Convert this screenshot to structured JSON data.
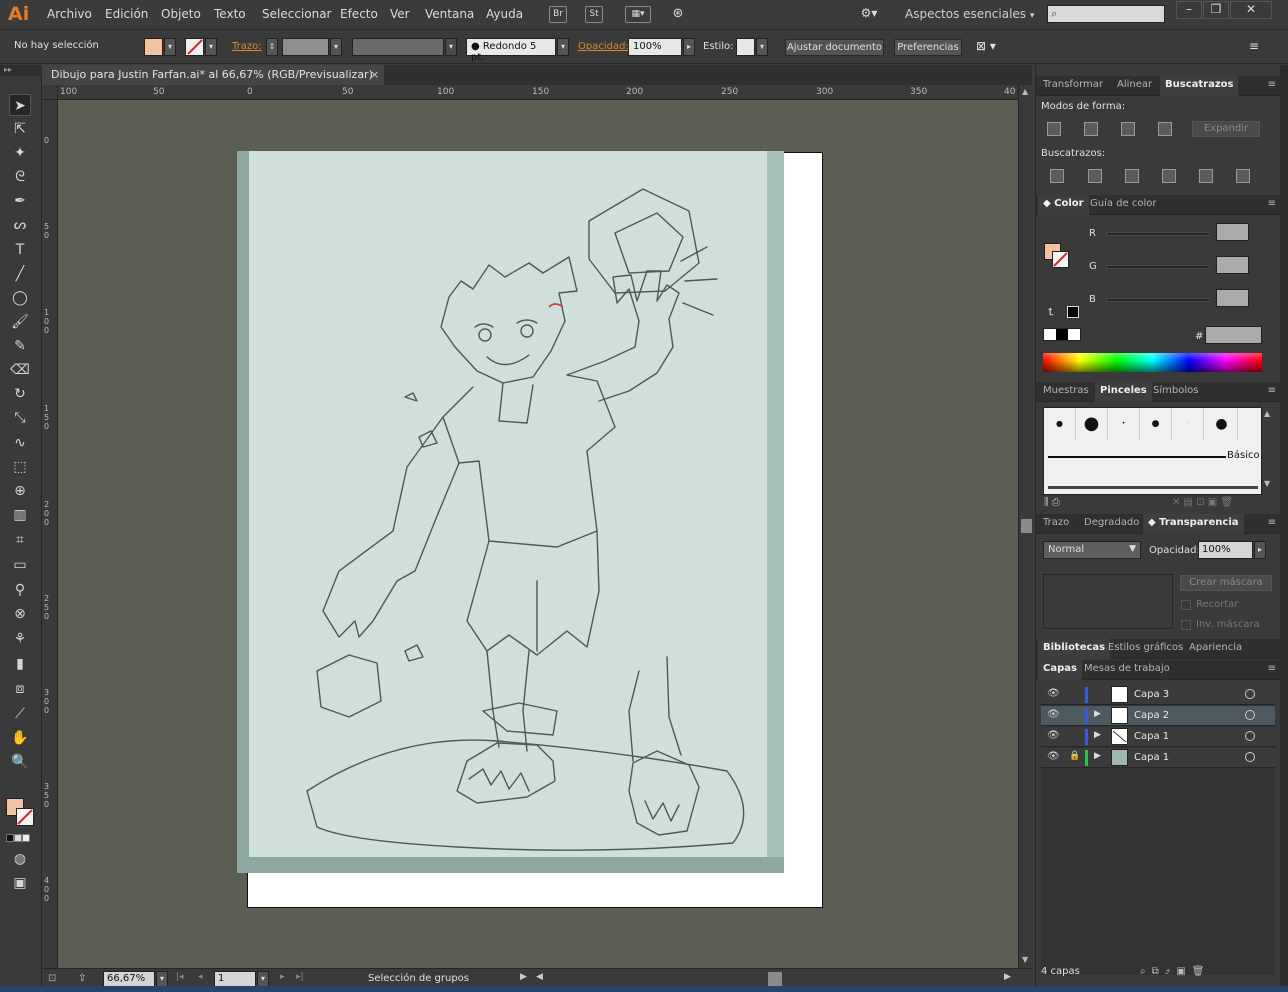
{
  "app": {
    "logo": "Ai",
    "menu": [
      "Archivo",
      "Edición",
      "Objeto",
      "Texto",
      "Seleccionar",
      "Efecto",
      "Ver",
      "Ventana",
      "Ayuda"
    ],
    "workspace": "Aspectos esenciales",
    "window_buttons": [
      "–",
      "❐",
      "✕"
    ]
  },
  "control_bar": {
    "selection_status": "No hay selección",
    "stroke_label": "Trazo:",
    "brush_value": "Redondo 5 pt.",
    "opacity_label": "Opacidad:",
    "opacity_value": "100%",
    "style_label": "Estilo:",
    "adjust_button": "Ajustar documento",
    "prefs_button": "Preferencias"
  },
  "document": {
    "tab_title": "Dibujo para Justin Farfan.ai* al 66,67% (RGB/Previsualizar)",
    "close_glyph": "×"
  },
  "rulers": {
    "h_ticks": [
      "100",
      "50",
      "0",
      "50",
      "100",
      "150",
      "200",
      "250",
      "300",
      "350",
      "40"
    ],
    "v_ticks": [
      "0",
      "50",
      "100",
      "150",
      "200",
      "250",
      "300",
      "350",
      "400"
    ]
  },
  "status_bar": {
    "zoom": "66,67%",
    "artboard": "1",
    "tool_status": "Selección de grupos"
  },
  "tools": [
    "selection-tool",
    "direct-selection-tool",
    "magic-wand-tool",
    "lasso-tool",
    "pen-tool",
    "curvature-tool",
    "type-tool",
    "line-tool",
    "ellipse-tool",
    "paintbrush-tool",
    "pencil-tool",
    "eraser-tool",
    "rotate-tool",
    "scale-tool",
    "warp-tool",
    "free-transform-tool",
    "shape-builder-tool",
    "perspective-grid-tool",
    "mesh-tool",
    "gradient-tool",
    "eyedropper-tool",
    "blend-tool",
    "symbol-sprayer-tool",
    "column-graph-tool",
    "artboard-tool",
    "slice-tool",
    "hand-tool",
    "zoom-tool"
  ],
  "panels": {
    "transform_tabs": [
      "Transformar",
      "Alinear",
      "Buscatrazos"
    ],
    "shape_modes_label": "Modos de forma:",
    "expand_button": "Expandir",
    "pathfinders_label": "Buscatrazos:",
    "color_tabs": [
      "Color",
      "Guía de color"
    ],
    "color_channels": [
      "R",
      "G",
      "B"
    ],
    "hex_symbol": "#",
    "brush_tabs": [
      "Muestras",
      "Pinceles",
      "Símbolos"
    ],
    "brush_basic_label": "Básico",
    "transparency_tabs": [
      "Trazo",
      "Degradado",
      "Transparencia"
    ],
    "blend_mode": "Normal",
    "opacity_label": "Opacidad:",
    "opacity_value": "100%",
    "create_mask_button": "Crear máscara",
    "clip_label": "Recortar",
    "invert_mask_label": "Inv. máscara",
    "library_tabs": [
      "Bibliotecas",
      "Estilos gráficos",
      "Apariencia"
    ],
    "layers_tabs": [
      "Capas",
      "Mesas de trabajo"
    ],
    "layers": [
      {
        "name": "Capa 3",
        "color": "#3a5bd9",
        "expanded": false,
        "locked": false,
        "selected": false
      },
      {
        "name": "Capa 2",
        "color": "#3a5bd9",
        "expanded": true,
        "locked": false,
        "selected": true
      },
      {
        "name": "Capa 1",
        "color": "#3a5bd9",
        "expanded": true,
        "locked": false,
        "selected": false
      },
      {
        "name": "Capa 1",
        "color": "#2fbf4a",
        "expanded": true,
        "locked": true,
        "selected": false
      }
    ],
    "layers_count": "4 capas"
  },
  "colors": {
    "accent_orange": "#e0872a",
    "canvas_bg": "#5b5e52",
    "fill_swatch": "#f3c2a1"
  }
}
